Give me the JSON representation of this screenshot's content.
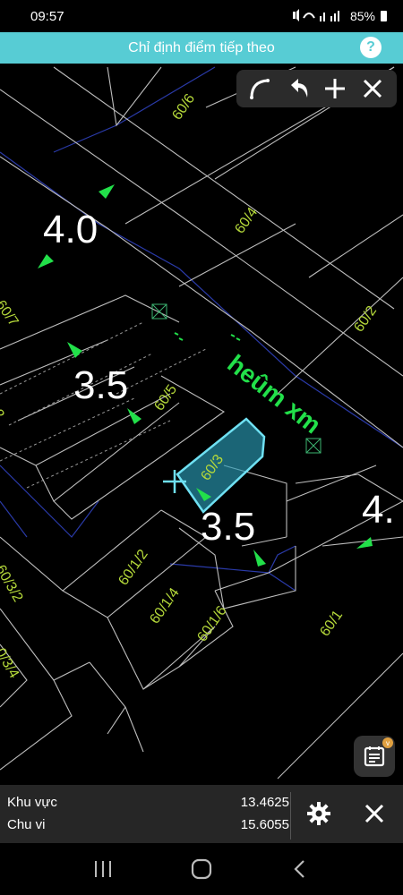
{
  "status_bar": {
    "time": "09:57",
    "battery": "85%",
    "icons": [
      "mute-icon",
      "wifi-icon",
      "signal-icon",
      "signal-icon",
      "battery-icon"
    ]
  },
  "header": {
    "title": "Chỉ định điểm tiếp theo",
    "help_label": "?"
  },
  "toolbar": {
    "tools": [
      "arc-icon",
      "undo-icon",
      "plus-icon",
      "close-icon"
    ]
  },
  "map": {
    "parcels": [
      "60/6",
      "60/4",
      "60/7",
      "60/2",
      "60/5",
      "2",
      "60/3",
      "60/3/2",
      "60/1/2",
      "60/1/4",
      "60/1/6",
      "60/1",
      "0/3/4"
    ],
    "dimensions": [
      "4.0",
      "3.5",
      "3.5",
      "4."
    ],
    "road_label": "heûm xm",
    "colors": {
      "selected_fill": "#2a9bb5",
      "selected_stroke": "#6fe0f2",
      "parcel_label": "#b5d93a",
      "road_label": "#22e04a",
      "lines": "#b8b8b8"
    }
  },
  "info": {
    "area_label": "Khu vực",
    "area_value": "13.4625",
    "perimeter_label": "Chu vi",
    "perimeter_value": "15.6055"
  },
  "notes_badge": "v",
  "nav": [
    "recent-apps-icon",
    "home-icon",
    "back-icon"
  ]
}
